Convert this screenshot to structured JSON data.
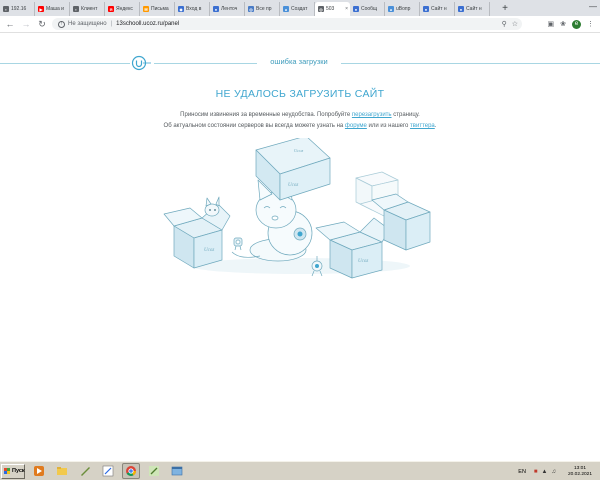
{
  "browser": {
    "tabs": [
      {
        "title": "192.16",
        "icon": "doc-icon",
        "color": "#5f6368"
      },
      {
        "title": "Маша и",
        "icon": "youtube-icon",
        "color": "#ff0000"
      },
      {
        "title": "Клиент",
        "icon": "doc-icon",
        "color": "#5f6368"
      },
      {
        "title": "Яндекс",
        "icon": "yandex-icon",
        "color": "#ff0000"
      },
      {
        "title": "Письма",
        "icon": "mail-icon",
        "color": "#ff9900"
      },
      {
        "title": "Вход в",
        "icon": "diamond-icon",
        "color": "#3b6fd1"
      },
      {
        "title": "Ленточ",
        "icon": "users-icon",
        "color": "#3b6fd1"
      },
      {
        "title": "Все пр",
        "icon": "globe-icon",
        "color": "#4a7cc6"
      },
      {
        "title": "Создат",
        "icon": "ucoz-icon",
        "color": "#4a90d9"
      },
      {
        "title": "503",
        "icon": "globe-icon",
        "color": "#5f6368",
        "active": true
      },
      {
        "title": "Сообщ",
        "icon": "users-icon",
        "color": "#3b6fd1"
      },
      {
        "title": "uВопр",
        "icon": "ucoz-icon",
        "color": "#4a90d9"
      },
      {
        "title": "Сайт н",
        "icon": "users-icon",
        "color": "#3b6fd1"
      },
      {
        "title": "Сайт н",
        "icon": "users-icon",
        "color": "#3b6fd1"
      }
    ],
    "new_tab_label": "+",
    "minimize_label": "—",
    "security_label": "Не защищено",
    "url": "13schooll.ucoz.ru/panel"
  },
  "page": {
    "header_label": "ошибка загрузки",
    "title": "НЕ УДАЛОСЬ ЗАГРУЗИТЬ САЙТ",
    "msg1_before": "Приносим извинения за временные неудобства. Попробуйте ",
    "msg1_link": "перезагрузить",
    "msg1_after": " страницу.",
    "msg2_before": "Об актуальном состоянии серверов вы всегда можете узнать на ",
    "msg2_link1": "форуме",
    "msg2_middle": " или из нашего ",
    "msg2_link2": "твиттера",
    "msg2_after": ".",
    "box_label": "Ucoz",
    "accent_color": "#3fa6cf"
  },
  "taskbar": {
    "start_label": "Пуск",
    "apps": [
      "media-player-icon",
      "folder-icon",
      "tools-icon",
      "paint-icon",
      "chrome-icon",
      "edit-icon",
      "window-icon"
    ],
    "lang": "EN",
    "time": "13:01",
    "date": "20.02.2021"
  }
}
